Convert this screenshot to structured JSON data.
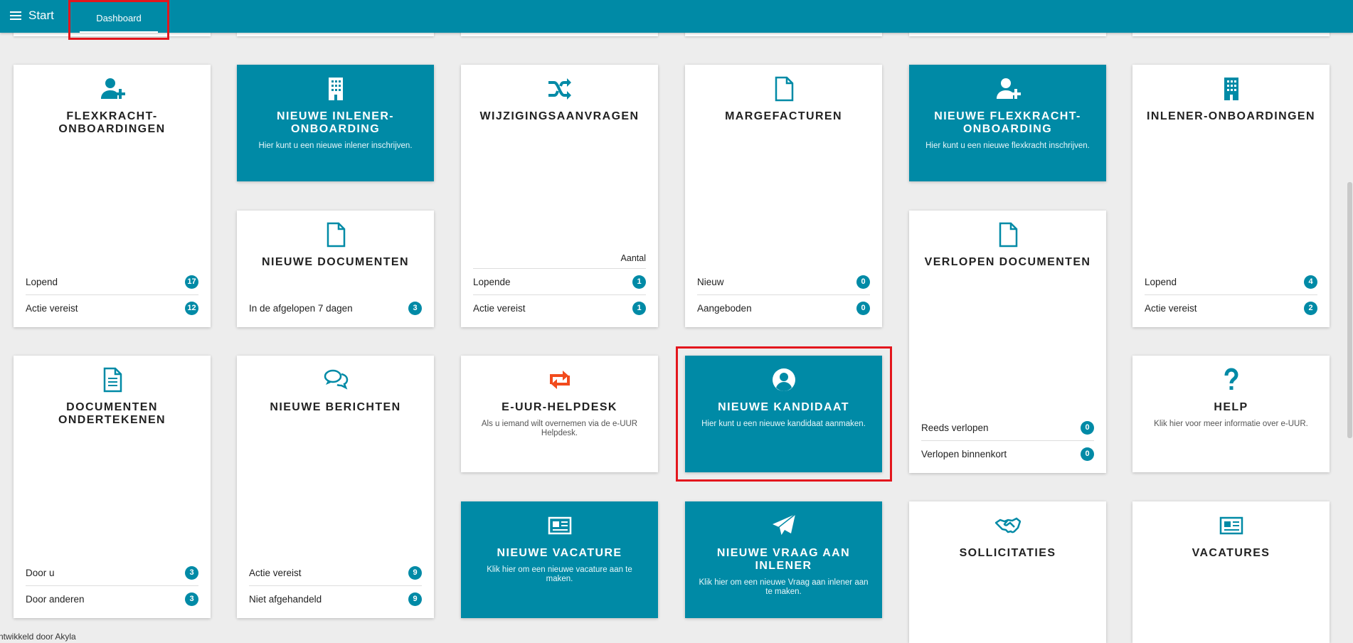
{
  "topbar": {
    "start_label": "Start",
    "dashboard_tab": "Dashboard"
  },
  "colors": {
    "primary": "#008aa6",
    "accent_orange": "#f24b1d",
    "highlight": "#e3161d"
  },
  "cards": {
    "flex_onb": {
      "title": "FLEXKRACHT-ONBOARDINGEN",
      "icon": "user-plus-icon",
      "rows": [
        {
          "label": "Lopend",
          "count": "17"
        },
        {
          "label": "Actie vereist",
          "count": "12"
        }
      ]
    },
    "new_inlener": {
      "title": "NIEUWE INLENER-ONBOARDING",
      "icon": "building-icon",
      "desc": "Hier kunt u een nieuwe inlener inschrijven."
    },
    "wijz": {
      "title": "WIJZIGINGSAANVRAGEN",
      "icon": "shuffle-icon",
      "header": "Aantal",
      "rows": [
        {
          "label": "Lopende",
          "count": "1"
        },
        {
          "label": "Actie vereist",
          "count": "1"
        }
      ]
    },
    "marge": {
      "title": "MARGEFACTUREN",
      "icon": "document-icon",
      "rows": [
        {
          "label": "Nieuw",
          "count": "0"
        },
        {
          "label": "Aangeboden",
          "count": "0"
        }
      ]
    },
    "new_flex": {
      "title": "NIEUWE FLEXKRACHT-ONBOARDING",
      "icon": "user-plus-icon",
      "desc": "Hier kunt u een nieuwe flexkracht inschrijven."
    },
    "inl_onb": {
      "title": "INLENER-ONBOARDINGEN",
      "icon": "building-icon",
      "rows": [
        {
          "label": "Lopend",
          "count": "4"
        },
        {
          "label": "Actie vereist",
          "count": "2"
        }
      ]
    },
    "new_docs": {
      "title": "NIEUWE DOCUMENTEN",
      "icon": "document-icon",
      "rows": [
        {
          "label": "In de afgelopen 7 dagen",
          "count": "3"
        }
      ]
    },
    "expired": {
      "title": "VERLOPEN DOCUMENTEN",
      "icon": "document-icon",
      "rows": [
        {
          "label": "Reeds verlopen",
          "count": "0"
        },
        {
          "label": "Verlopen binnenkort",
          "count": "0"
        }
      ]
    },
    "sign": {
      "title": "DOCUMENTEN ONDERTEKENEN",
      "icon": "document-text-icon",
      "rows": [
        {
          "label": "Door u",
          "count": "3"
        },
        {
          "label": "Door anderen",
          "count": "3"
        }
      ]
    },
    "messages": {
      "title": "NIEUWE BERICHTEN",
      "icon": "chat-bubbles-icon",
      "rows": [
        {
          "label": "Actie vereist",
          "count": "9"
        },
        {
          "label": "Niet afgehandeld",
          "count": "9"
        }
      ]
    },
    "helpdesk": {
      "title": "E-UUR-HELPDESK",
      "icon": "retweet-icon",
      "desc": "Als u iemand wilt overnemen via de e-UUR Helpdesk."
    },
    "kandidaat": {
      "title": "NIEUWE KANDIDAAT",
      "icon": "user-circle-icon",
      "desc": "Hier kunt u een nieuwe kandidaat aanmaken."
    },
    "help": {
      "title": "HELP",
      "icon": "question-icon",
      "desc": "Klik hier voor meer informatie over e-UUR."
    },
    "vacature": {
      "title": "NIEUWE VACATURE",
      "icon": "newspaper-icon",
      "desc": "Klik hier om een nieuwe vacature aan te maken."
    },
    "vraag": {
      "title": "NIEUWE VRAAG AAN INLENER",
      "icon": "paper-plane-icon",
      "desc": "Klik hier om een nieuwe Vraag aan inlener aan te maken."
    },
    "sollicitaties": {
      "title": "SOLLICITATIES",
      "icon": "handshake-icon"
    },
    "vacatures": {
      "title": "VACATURES",
      "icon": "newspaper-icon"
    }
  },
  "footer": {
    "text": "ntwikkeld door Akyla"
  }
}
